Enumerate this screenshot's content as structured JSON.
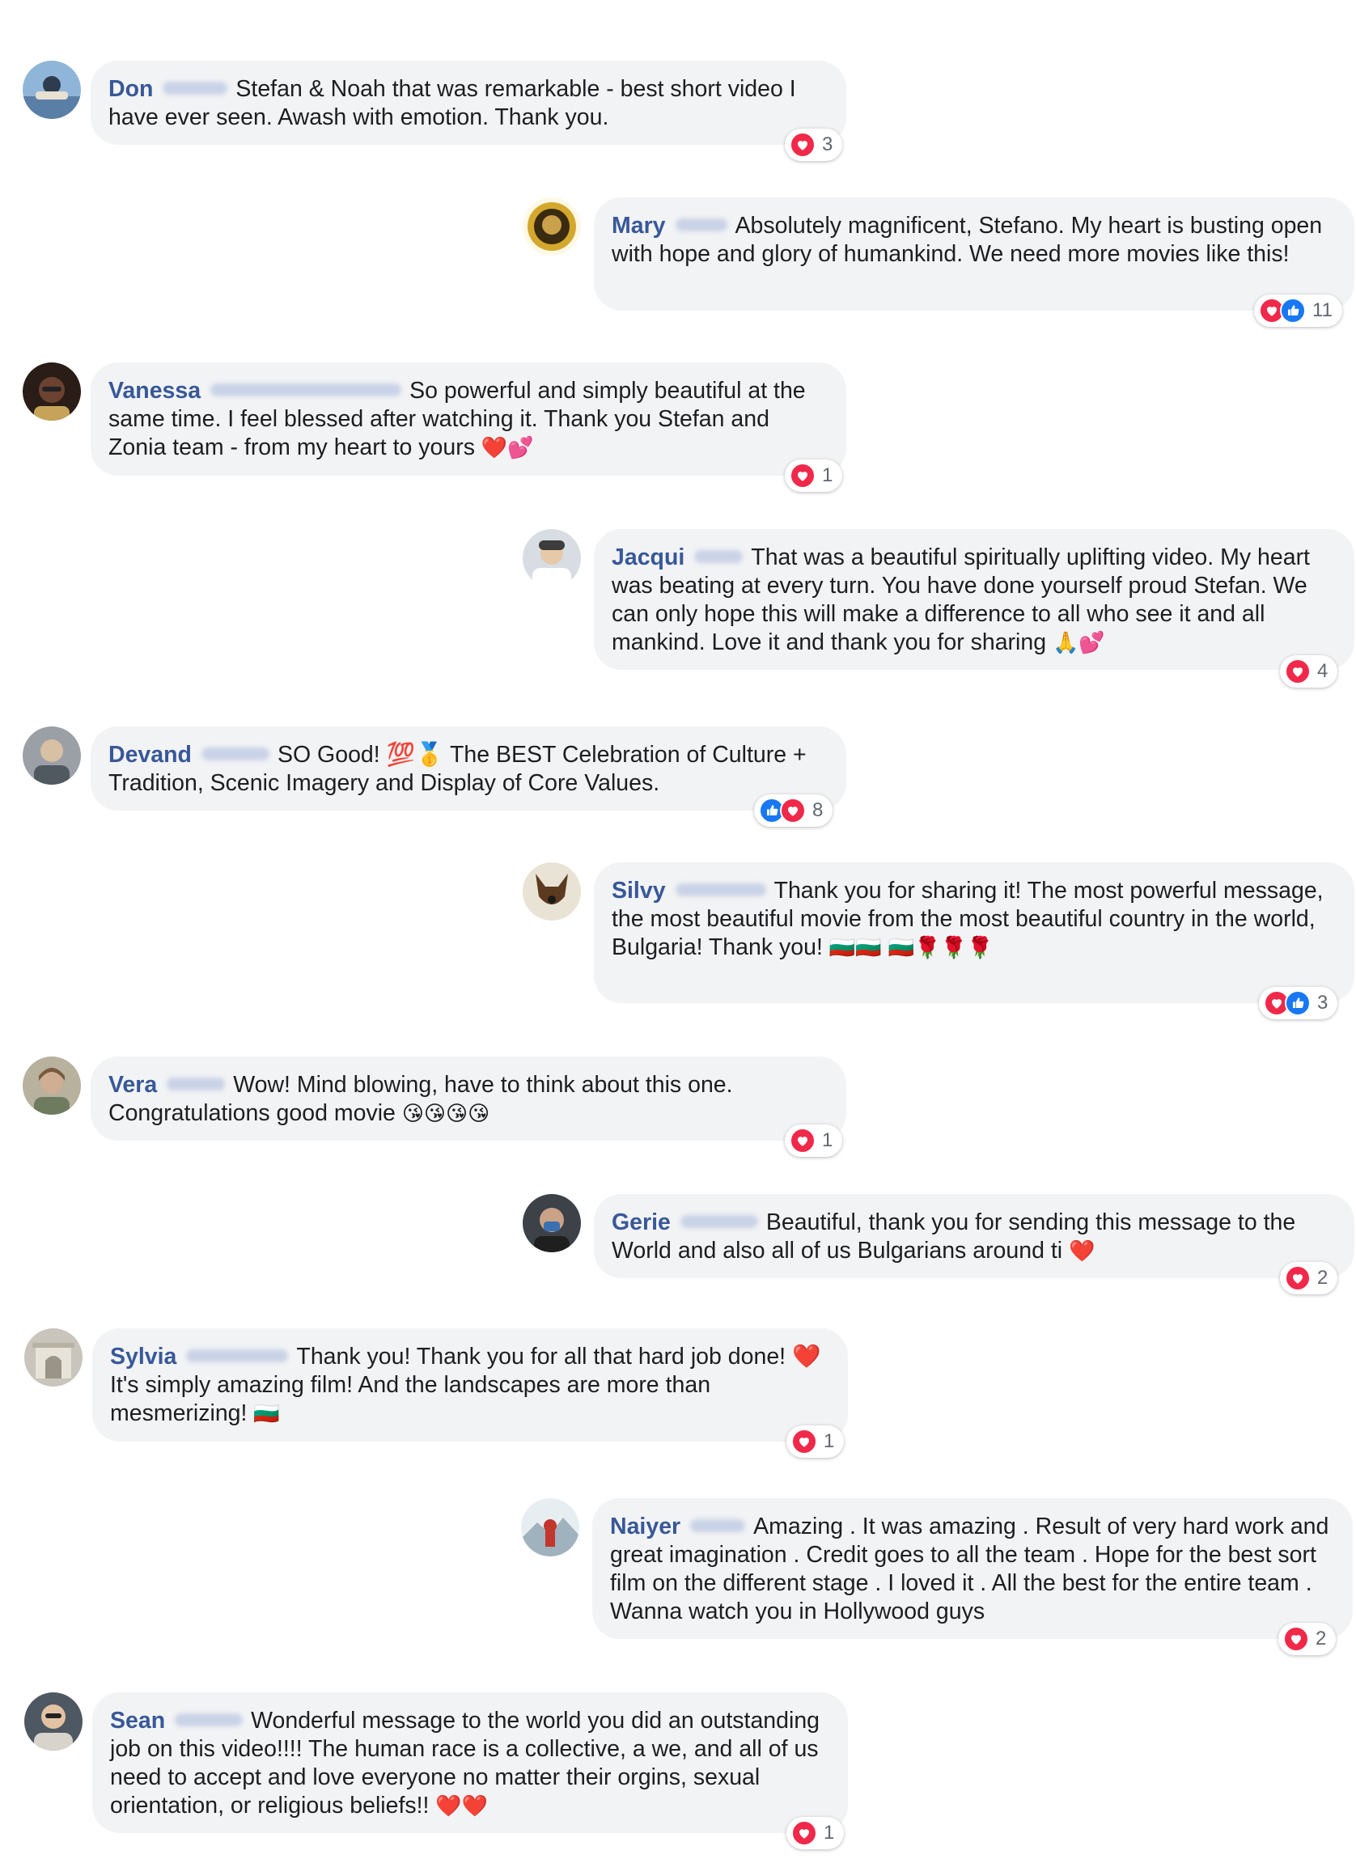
{
  "comments": [
    {
      "name": "Don",
      "text": "Stefan & Noah that was remarkable - best short video I have ever seen. Awash with emotion. Thank you.",
      "emoji": "",
      "reactions": [
        "love"
      ],
      "count": "3"
    },
    {
      "name": "Mary",
      "text": "Absolutely magnificent, Stefano. My heart is busting open with hope and glory of humankind. We need more movies like this!",
      "emoji": "",
      "reactions": [
        "love",
        "like"
      ],
      "count": "11"
    },
    {
      "name": "Vanessa",
      "text": "So powerful and simply beautiful at the same time. I feel blessed after watching it. Thank you Stefan and Zonia team - from my heart to yours",
      "emoji": "❤️💕",
      "reactions": [
        "love"
      ],
      "count": "1"
    },
    {
      "name": "Jacqui",
      "text": "That was a beautiful spiritually uplifting video. My heart was beating at every turn. You have done yourself proud Stefan. We can only hope this will make a difference to all who see it and all mankind. Love it and thank you for sharing",
      "emoji": "🙏💕",
      "reactions": [
        "love"
      ],
      "count": "4"
    },
    {
      "name": "Devand",
      "text": "SO Good! 💯🥇 The BEST Celebration of Culture + Tradition, Scenic Imagery and Display of Core Values.",
      "emoji": "",
      "reactions": [
        "like",
        "love"
      ],
      "count": "8"
    },
    {
      "name": "Silvy",
      "text": "Thank you for sharing it! The most powerful message, the most beautiful movie from the most beautiful country in the world, Bulgaria! Thank you!",
      "emoji": "🇧🇬🇧🇬 🇧🇬🌹🌹🌹",
      "reactions": [
        "love",
        "like"
      ],
      "count": "3"
    },
    {
      "name": "Vera",
      "text": "Wow! Mind blowing, have to think about this one. Congratulations good movie",
      "emoji": "😘😘😘😘",
      "reactions": [
        "love"
      ],
      "count": "1"
    },
    {
      "name": "Gerie",
      "text": "Beautiful, thank you for sending this message to the World and also all of us Bulgarians around ti",
      "emoji": "❤️",
      "reactions": [
        "love"
      ],
      "count": "2"
    },
    {
      "name": "Sylvia",
      "text": "Thank you! Thank you for all that hard job done! ❤️ It's simply amazing film! And the landscapes are more than mesmerizing!",
      "emoji": "🇧🇬",
      "reactions": [
        "love"
      ],
      "count": "1"
    },
    {
      "name": "Naiyer",
      "text": "Amazing . It was amazing . Result of very hard work and great imagination . Credit goes to all the team . Hope for the best sort film on the different stage . I loved it . All the best for the entire team . Wanna watch you in Hollywood guys",
      "emoji": "",
      "reactions": [
        "love"
      ],
      "count": "2"
    },
    {
      "name": "Sean",
      "text": "Wonderful message to the world you did an outstanding job on this video!!!! The human race is a collective, a we, and all of us need to accept and love everyone no matter their orgins, sexual orientation, or religious beliefs!!",
      "emoji": "❤️❤️",
      "reactions": [
        "love"
      ],
      "count": "1"
    }
  ],
  "colors": {
    "bubble": "#f2f3f5",
    "name": "#385898",
    "love": "#f0284a",
    "like": "#1877f2",
    "count": "#606770"
  },
  "icons": {
    "love": "heart-icon",
    "like": "thumbs-up-icon"
  }
}
